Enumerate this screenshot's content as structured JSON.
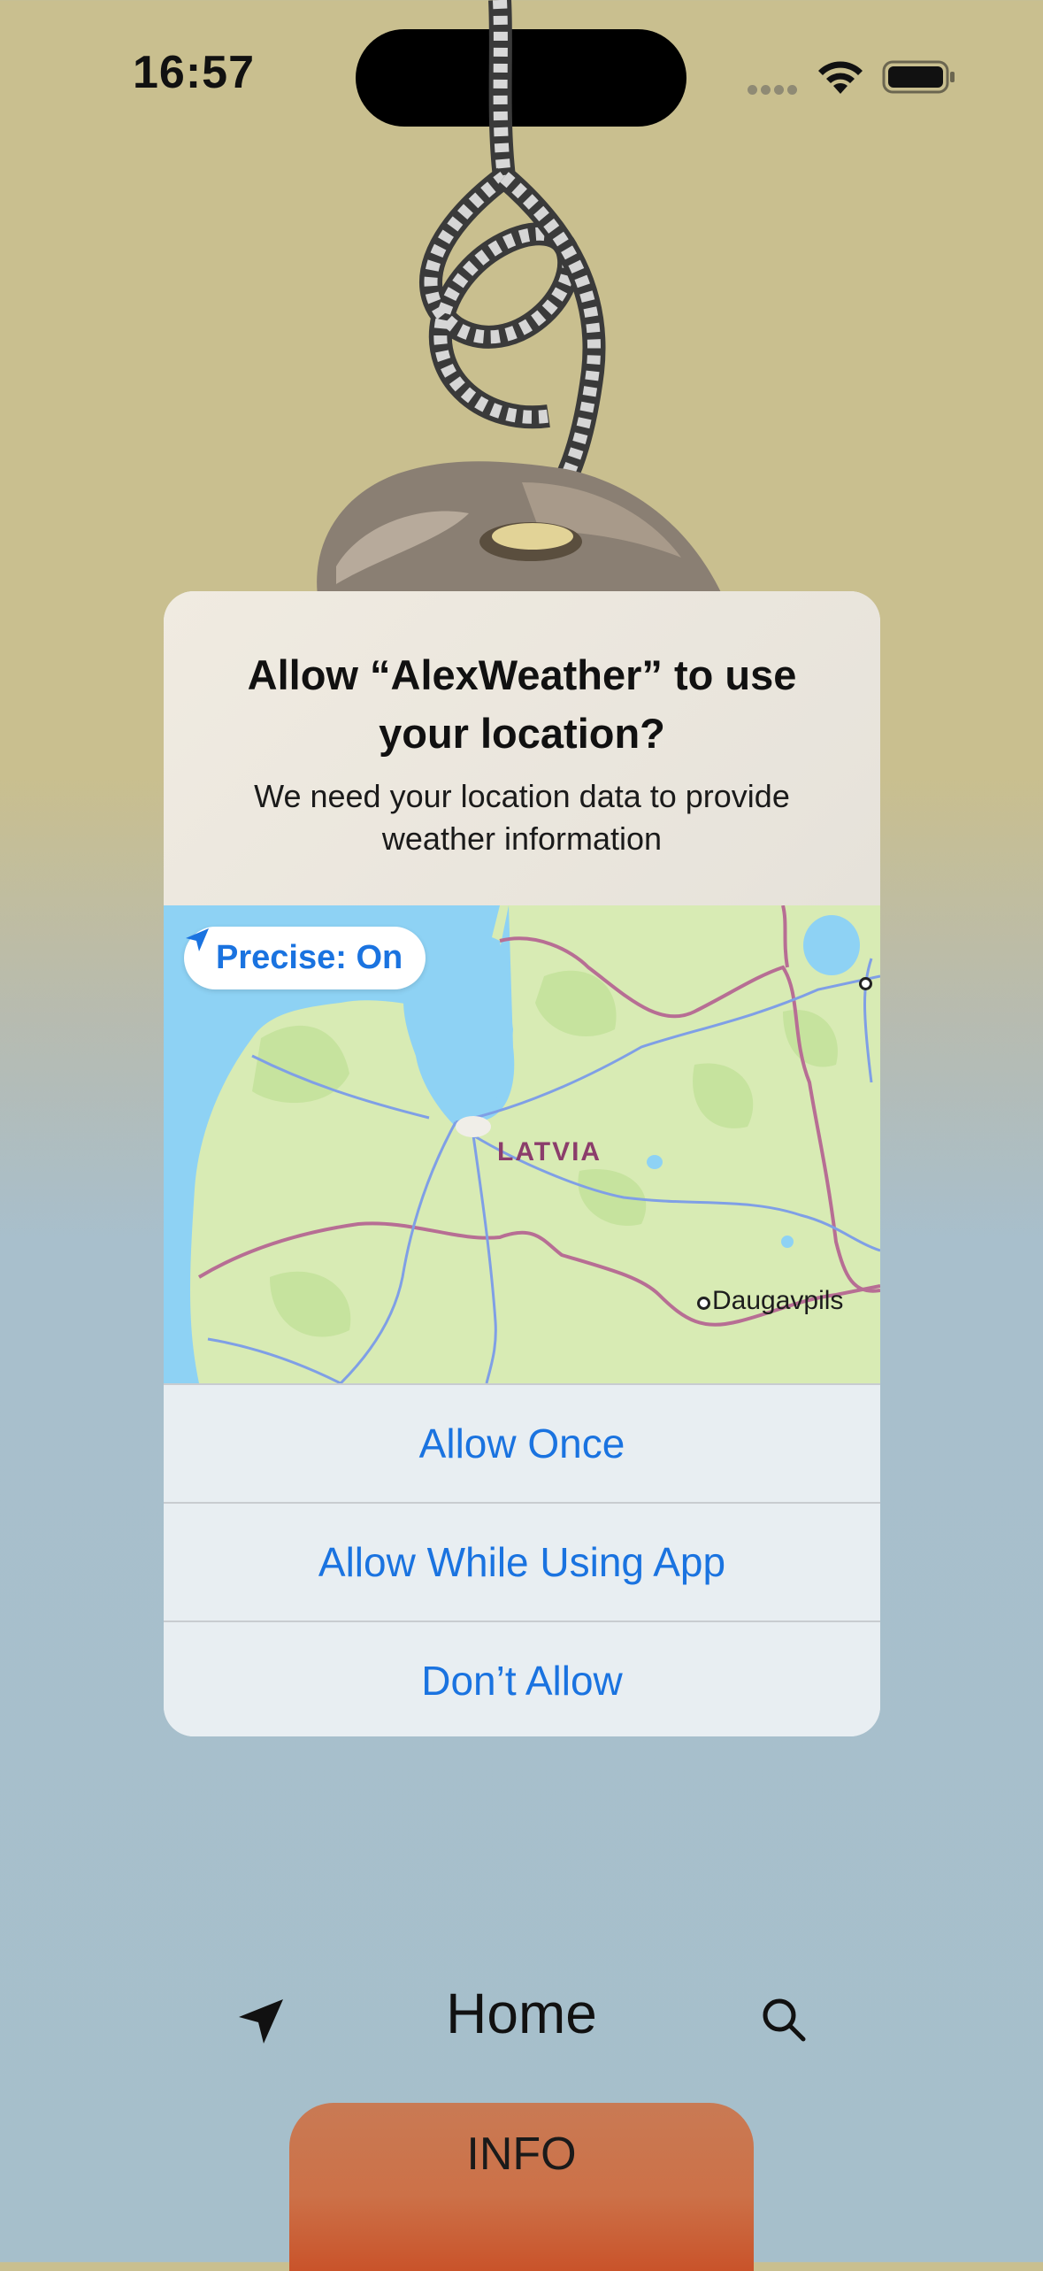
{
  "status_bar": {
    "time": "16:57",
    "icons": [
      "cellular-dots-icon",
      "wifi-icon",
      "battery-icon"
    ]
  },
  "permission_alert": {
    "title": "Allow “AlexWeather” to use your location?",
    "message": "We need your location data to provide weather information",
    "precise_toggle_label": "Precise: On",
    "map": {
      "country_label": "LATVIA",
      "city_label": "Daugavpils"
    },
    "buttons": {
      "allow_once": "Allow Once",
      "allow_while_using": "Allow While Using App",
      "dont_allow": "Don’t Allow"
    }
  },
  "bottom_nav": {
    "title": "Home",
    "left_icon": "location-arrow-icon",
    "right_icon": "search-icon"
  },
  "info_tab": {
    "label": "INFO"
  },
  "colors": {
    "accent": "#1a73e0",
    "background_top": "#c9bf8f",
    "background_bottom": "#a6bfcb",
    "info_tab": "#cc7148"
  }
}
